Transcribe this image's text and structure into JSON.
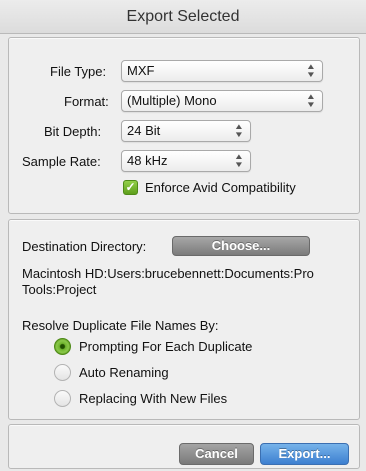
{
  "window": {
    "title": "Export Selected"
  },
  "file_type": {
    "label": "File Type:",
    "value": "MXF"
  },
  "format": {
    "label": "Format:",
    "value": "(Multiple) Mono"
  },
  "bit_depth": {
    "label": "Bit Depth:",
    "value": "24 Bit"
  },
  "sample_rate": {
    "label": "Sample Rate:",
    "value": "48 kHz"
  },
  "enforce_avid": {
    "label": "Enforce Avid Compatibility",
    "checked": true
  },
  "destination": {
    "label": "Destination Directory:",
    "choose_label": "Choose...",
    "path": "Macintosh HD:Users:brucebennett:Documents:Pro Tools:Project"
  },
  "resolve": {
    "label": "Resolve Duplicate File Names By:",
    "options": [
      {
        "label": "Prompting For Each Duplicate",
        "selected": true
      },
      {
        "label": "Auto Renaming",
        "selected": false
      },
      {
        "label": "Replacing With New Files",
        "selected": false
      }
    ]
  },
  "buttons": {
    "cancel": "Cancel",
    "export": "Export..."
  },
  "colors": {
    "accent_green": "#6fb32d",
    "export_blue": "#3d7fd0"
  }
}
